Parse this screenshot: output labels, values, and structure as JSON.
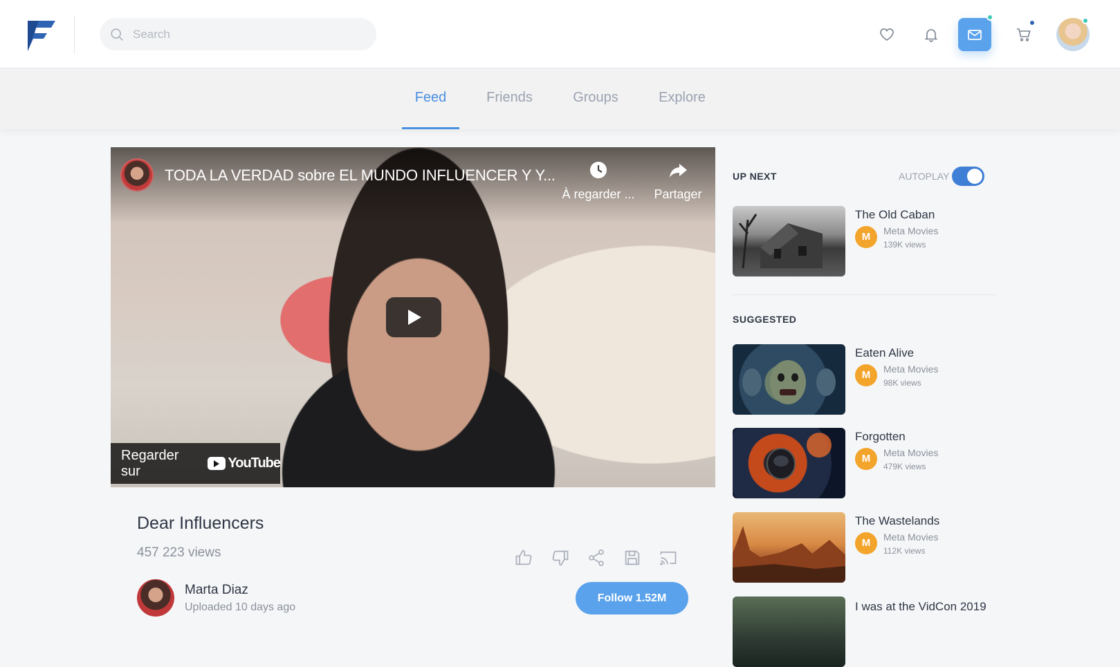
{
  "header": {
    "search_placeholder": "Search",
    "accent_color": "#5aa2ec",
    "icons": [
      "heart-icon",
      "bell-icon",
      "mail-icon",
      "cart-icon"
    ]
  },
  "tabs": [
    {
      "label": "Feed",
      "active": true
    },
    {
      "label": "Friends",
      "active": false
    },
    {
      "label": "Groups",
      "active": false
    },
    {
      "label": "Explore",
      "active": false
    }
  ],
  "player": {
    "title": "TODA LA VERDAD sobre EL MUNDO INFLUENCER Y Y...",
    "watch_later": "À regarder ...",
    "share": "Partager",
    "watch_on": "Regarder sur",
    "youtube": "YouTube"
  },
  "video": {
    "name": "Dear Influencers",
    "views": "457 223 views",
    "author": "Marta Diaz",
    "uploaded": "Uploaded 10 days ago",
    "follow": "Follow 1.52M"
  },
  "sidebar": {
    "up_next": "UP NEXT",
    "autoplay": "AUTOPLAY",
    "autoplay_on": true,
    "suggested": "SUGGESTED",
    "badge": "M",
    "items": [
      {
        "title": "The Old Caban",
        "channel": "Meta Movies",
        "views": "139K views"
      },
      {
        "title": "Eaten Alive",
        "channel": "Meta Movies",
        "views": "98K views"
      },
      {
        "title": "Forgotten",
        "channel": "Meta Movies",
        "views": "479K views"
      },
      {
        "title": "The Wastelands",
        "channel": "Meta Movies",
        "views": "112K views"
      },
      {
        "title": "I was at the VidCon 2019",
        "channel": "",
        "views": ""
      }
    ]
  }
}
